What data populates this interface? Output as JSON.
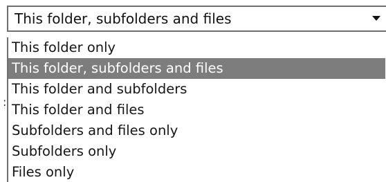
{
  "dropdown": {
    "selected_value": "This folder, subfolders and files",
    "arrow_icon": "chevron-down-icon"
  },
  "options": [
    {
      "label": "This folder only",
      "selected": false
    },
    {
      "label": "This folder, subfolders and files",
      "selected": true
    },
    {
      "label": "This folder and subfolders",
      "selected": false
    },
    {
      "label": "This folder and files",
      "selected": false
    },
    {
      "label": "Subfolders and files only",
      "selected": false
    },
    {
      "label": "Subfolders only",
      "selected": false
    },
    {
      "label": "Files only",
      "selected": false
    }
  ],
  "colors": {
    "highlight": "#7d7d7d",
    "border": "#6f6f6f",
    "text": "#161616"
  }
}
